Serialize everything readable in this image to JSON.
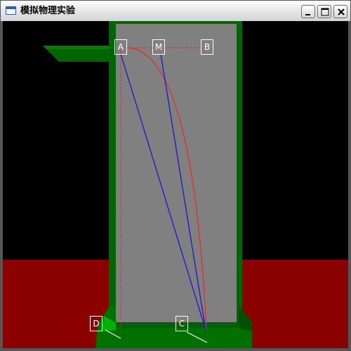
{
  "window": {
    "title": "模拟物理实验",
    "icon": "application-window-icon",
    "buttons": {
      "minimize": "minimize-icon",
      "maximize": "maximize-icon",
      "close": "close-icon"
    }
  },
  "scene": {
    "colors": {
      "background": "#000000",
      "floor": "#8B0000",
      "frame": "#006400",
      "board": "#808080",
      "curve": "#E03030",
      "chord": "#2020C8"
    },
    "labels": {
      "a": "A",
      "m": "M",
      "b": "B",
      "c": "C",
      "d": "D"
    }
  }
}
